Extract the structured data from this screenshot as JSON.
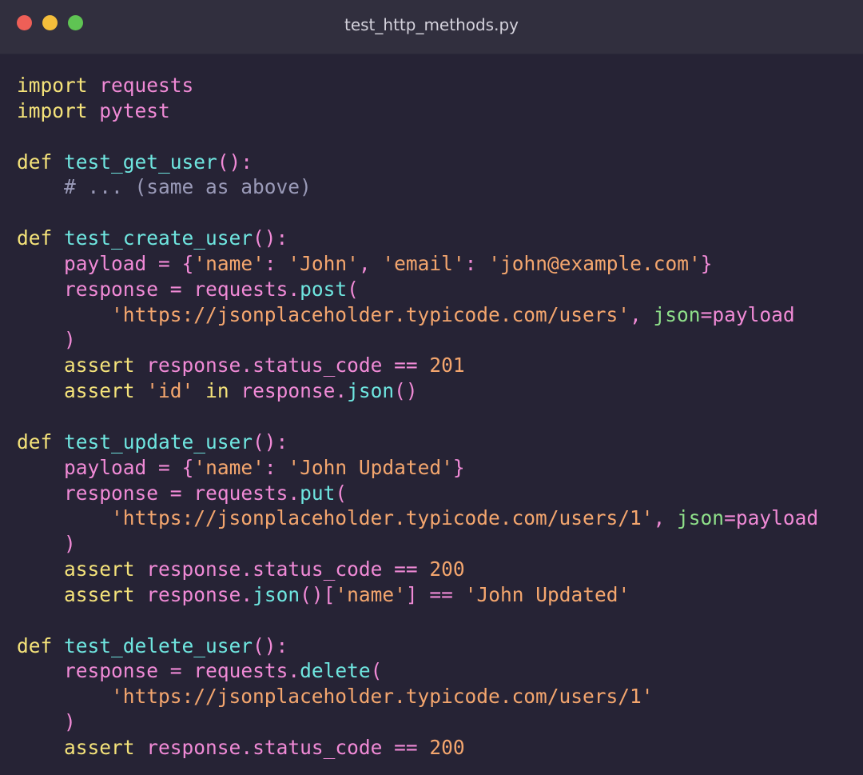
{
  "window": {
    "title": "test_http_methods.py",
    "traffic_lights": [
      {
        "name": "close",
        "color": "#ee5f57"
      },
      {
        "name": "minimize",
        "color": "#f4be3b"
      },
      {
        "name": "zoom",
        "color": "#5fc453"
      }
    ]
  },
  "colors": {
    "keyword": "#f5e37a",
    "function": "#6fe6e0",
    "identifier": "#f08ad6",
    "string": "#f4a66e",
    "comment": "#9a9ab8",
    "kwarg": "#8fe08a",
    "background": "#262335"
  },
  "code": {
    "lines": [
      [
        {
          "t": "import",
          "c": "kw"
        },
        {
          "t": " "
        },
        {
          "t": "requests",
          "c": "id"
        }
      ],
      [
        {
          "t": "import",
          "c": "kw"
        },
        {
          "t": " "
        },
        {
          "t": "pytest",
          "c": "id"
        }
      ],
      [],
      [
        {
          "t": "def",
          "c": "kw"
        },
        {
          "t": " "
        },
        {
          "t": "test_get_user",
          "c": "fn"
        },
        {
          "t": "():",
          "c": "pu"
        }
      ],
      [
        {
          "t": "    "
        },
        {
          "t": "# ... (same as above)",
          "c": "cm"
        }
      ],
      [],
      [
        {
          "t": "def",
          "c": "kw"
        },
        {
          "t": " "
        },
        {
          "t": "test_create_user",
          "c": "fn"
        },
        {
          "t": "():",
          "c": "pu"
        }
      ],
      [
        {
          "t": "    "
        },
        {
          "t": "payload",
          "c": "id"
        },
        {
          "t": " "
        },
        {
          "t": "=",
          "c": "op"
        },
        {
          "t": " "
        },
        {
          "t": "{",
          "c": "pu"
        },
        {
          "t": "'name'",
          "c": "str"
        },
        {
          "t": ": ",
          "c": "pu"
        },
        {
          "t": "'John'",
          "c": "str"
        },
        {
          "t": ", ",
          "c": "pu"
        },
        {
          "t": "'email'",
          "c": "str"
        },
        {
          "t": ": ",
          "c": "pu"
        },
        {
          "t": "'john@example.com'",
          "c": "str"
        },
        {
          "t": "}",
          "c": "pu"
        }
      ],
      [
        {
          "t": "    "
        },
        {
          "t": "response",
          "c": "id"
        },
        {
          "t": " "
        },
        {
          "t": "=",
          "c": "op"
        },
        {
          "t": " "
        },
        {
          "t": "requests",
          "c": "id"
        },
        {
          "t": ".",
          "c": "pu"
        },
        {
          "t": "post",
          "c": "fn"
        },
        {
          "t": "(",
          "c": "pu"
        }
      ],
      [
        {
          "t": "        "
        },
        {
          "t": "'https://jsonplaceholder.typicode.com/users'",
          "c": "str"
        },
        {
          "t": ", ",
          "c": "pu"
        },
        {
          "t": "json",
          "c": "kwarg"
        },
        {
          "t": "=",
          "c": "op"
        },
        {
          "t": "payload",
          "c": "id"
        }
      ],
      [
        {
          "t": "    "
        },
        {
          "t": ")",
          "c": "pu"
        }
      ],
      [
        {
          "t": "    "
        },
        {
          "t": "assert",
          "c": "kw"
        },
        {
          "t": " "
        },
        {
          "t": "response",
          "c": "id"
        },
        {
          "t": ".",
          "c": "pu"
        },
        {
          "t": "status_code",
          "c": "id"
        },
        {
          "t": " "
        },
        {
          "t": "==",
          "c": "op"
        },
        {
          "t": " "
        },
        {
          "t": "201",
          "c": "num"
        }
      ],
      [
        {
          "t": "    "
        },
        {
          "t": "assert",
          "c": "kw"
        },
        {
          "t": " "
        },
        {
          "t": "'id'",
          "c": "str"
        },
        {
          "t": " "
        },
        {
          "t": "in",
          "c": "kw"
        },
        {
          "t": " "
        },
        {
          "t": "response",
          "c": "id"
        },
        {
          "t": ".",
          "c": "pu"
        },
        {
          "t": "json",
          "c": "fn"
        },
        {
          "t": "()",
          "c": "pu"
        }
      ],
      [],
      [
        {
          "t": "def",
          "c": "kw"
        },
        {
          "t": " "
        },
        {
          "t": "test_update_user",
          "c": "fn"
        },
        {
          "t": "():",
          "c": "pu"
        }
      ],
      [
        {
          "t": "    "
        },
        {
          "t": "payload",
          "c": "id"
        },
        {
          "t": " "
        },
        {
          "t": "=",
          "c": "op"
        },
        {
          "t": " "
        },
        {
          "t": "{",
          "c": "pu"
        },
        {
          "t": "'name'",
          "c": "str"
        },
        {
          "t": ": ",
          "c": "pu"
        },
        {
          "t": "'John Updated'",
          "c": "str"
        },
        {
          "t": "}",
          "c": "pu"
        }
      ],
      [
        {
          "t": "    "
        },
        {
          "t": "response",
          "c": "id"
        },
        {
          "t": " "
        },
        {
          "t": "=",
          "c": "op"
        },
        {
          "t": " "
        },
        {
          "t": "requests",
          "c": "id"
        },
        {
          "t": ".",
          "c": "pu"
        },
        {
          "t": "put",
          "c": "fn"
        },
        {
          "t": "(",
          "c": "pu"
        }
      ],
      [
        {
          "t": "        "
        },
        {
          "t": "'https://jsonplaceholder.typicode.com/users/1'",
          "c": "str"
        },
        {
          "t": ", ",
          "c": "pu"
        },
        {
          "t": "json",
          "c": "kwarg"
        },
        {
          "t": "=",
          "c": "op"
        },
        {
          "t": "payload",
          "c": "id"
        }
      ],
      [
        {
          "t": "    "
        },
        {
          "t": ")",
          "c": "pu"
        }
      ],
      [
        {
          "t": "    "
        },
        {
          "t": "assert",
          "c": "kw"
        },
        {
          "t": " "
        },
        {
          "t": "response",
          "c": "id"
        },
        {
          "t": ".",
          "c": "pu"
        },
        {
          "t": "status_code",
          "c": "id"
        },
        {
          "t": " "
        },
        {
          "t": "==",
          "c": "op"
        },
        {
          "t": " "
        },
        {
          "t": "200",
          "c": "num"
        }
      ],
      [
        {
          "t": "    "
        },
        {
          "t": "assert",
          "c": "kw"
        },
        {
          "t": " "
        },
        {
          "t": "response",
          "c": "id"
        },
        {
          "t": ".",
          "c": "pu"
        },
        {
          "t": "json",
          "c": "fn"
        },
        {
          "t": "()[",
          "c": "pu"
        },
        {
          "t": "'name'",
          "c": "str"
        },
        {
          "t": "]",
          "c": "pu"
        },
        {
          "t": " "
        },
        {
          "t": "==",
          "c": "op"
        },
        {
          "t": " "
        },
        {
          "t": "'John Updated'",
          "c": "str"
        }
      ],
      [],
      [
        {
          "t": "def",
          "c": "kw"
        },
        {
          "t": " "
        },
        {
          "t": "test_delete_user",
          "c": "fn"
        },
        {
          "t": "():",
          "c": "pu"
        }
      ],
      [
        {
          "t": "    "
        },
        {
          "t": "response",
          "c": "id"
        },
        {
          "t": " "
        },
        {
          "t": "=",
          "c": "op"
        },
        {
          "t": " "
        },
        {
          "t": "requests",
          "c": "id"
        },
        {
          "t": ".",
          "c": "pu"
        },
        {
          "t": "delete",
          "c": "fn"
        },
        {
          "t": "(",
          "c": "pu"
        }
      ],
      [
        {
          "t": "        "
        },
        {
          "t": "'https://jsonplaceholder.typicode.com/users/1'",
          "c": "str"
        }
      ],
      [
        {
          "t": "    "
        },
        {
          "t": ")",
          "c": "pu"
        }
      ],
      [
        {
          "t": "    "
        },
        {
          "t": "assert",
          "c": "kw"
        },
        {
          "t": " "
        },
        {
          "t": "response",
          "c": "id"
        },
        {
          "t": ".",
          "c": "pu"
        },
        {
          "t": "status_code",
          "c": "id"
        },
        {
          "t": " "
        },
        {
          "t": "==",
          "c": "op"
        },
        {
          "t": " "
        },
        {
          "t": "200",
          "c": "num"
        }
      ]
    ]
  }
}
